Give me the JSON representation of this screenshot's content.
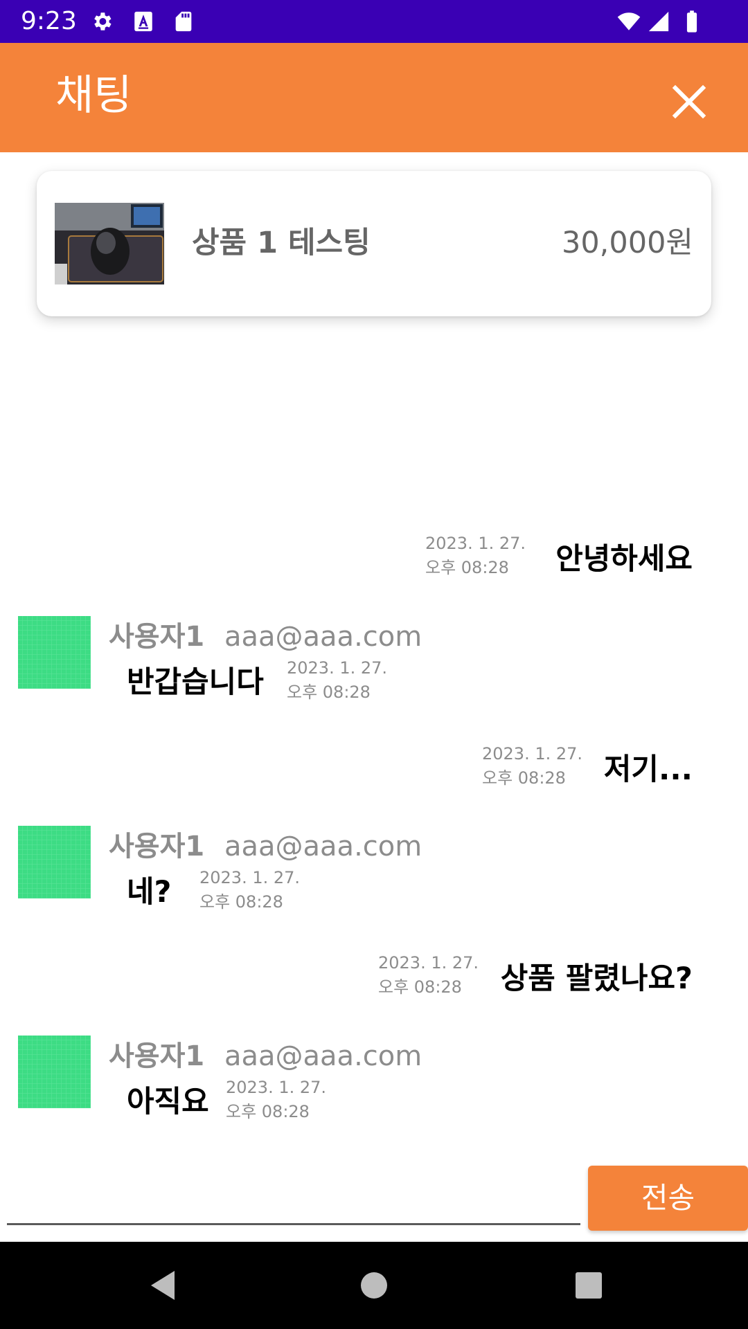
{
  "status_bar": {
    "time": "9:23",
    "icons": [
      "gear-icon",
      "font-a-icon",
      "sd-card-icon",
      "wifi-icon",
      "signal-icon",
      "battery-icon"
    ]
  },
  "app_bar": {
    "title": "채팅",
    "close_icon": "close-icon"
  },
  "product": {
    "name": "상품 1 테스팅",
    "price": "30,000원"
  },
  "messages": [
    {
      "side": "right",
      "text": "안녕하세요",
      "date": "2023. 1. 27.",
      "time": "오후 08:28"
    },
    {
      "side": "left",
      "user": "사용자1",
      "email": "aaa@aaa.com",
      "text": "반갑습니다",
      "date": "2023. 1. 27.",
      "time": "오후 08:28"
    },
    {
      "side": "right",
      "text": "저기...",
      "date": "2023. 1. 27.",
      "time": "오후 08:28"
    },
    {
      "side": "left",
      "user": "사용자1",
      "email": "aaa@aaa.com",
      "text": "네?",
      "date": "2023. 1. 27.",
      "time": "오후 08:28"
    },
    {
      "side": "right",
      "text": "상품 팔렸나요?",
      "date": "2023. 1. 27.",
      "time": "오후 08:28"
    },
    {
      "side": "left",
      "user": "사용자1",
      "email": "aaa@aaa.com",
      "text": "아직요",
      "date": "2023. 1. 27.",
      "time": "오후 08:28"
    }
  ],
  "composer": {
    "input_value": "",
    "send_label": "전송"
  },
  "colors": {
    "status_bar": "#3a00b4",
    "accent": "#f4833a",
    "avatar": "#3ddc84"
  },
  "nav_bar": {
    "icons": [
      "back-icon",
      "home-icon",
      "recents-icon"
    ]
  }
}
